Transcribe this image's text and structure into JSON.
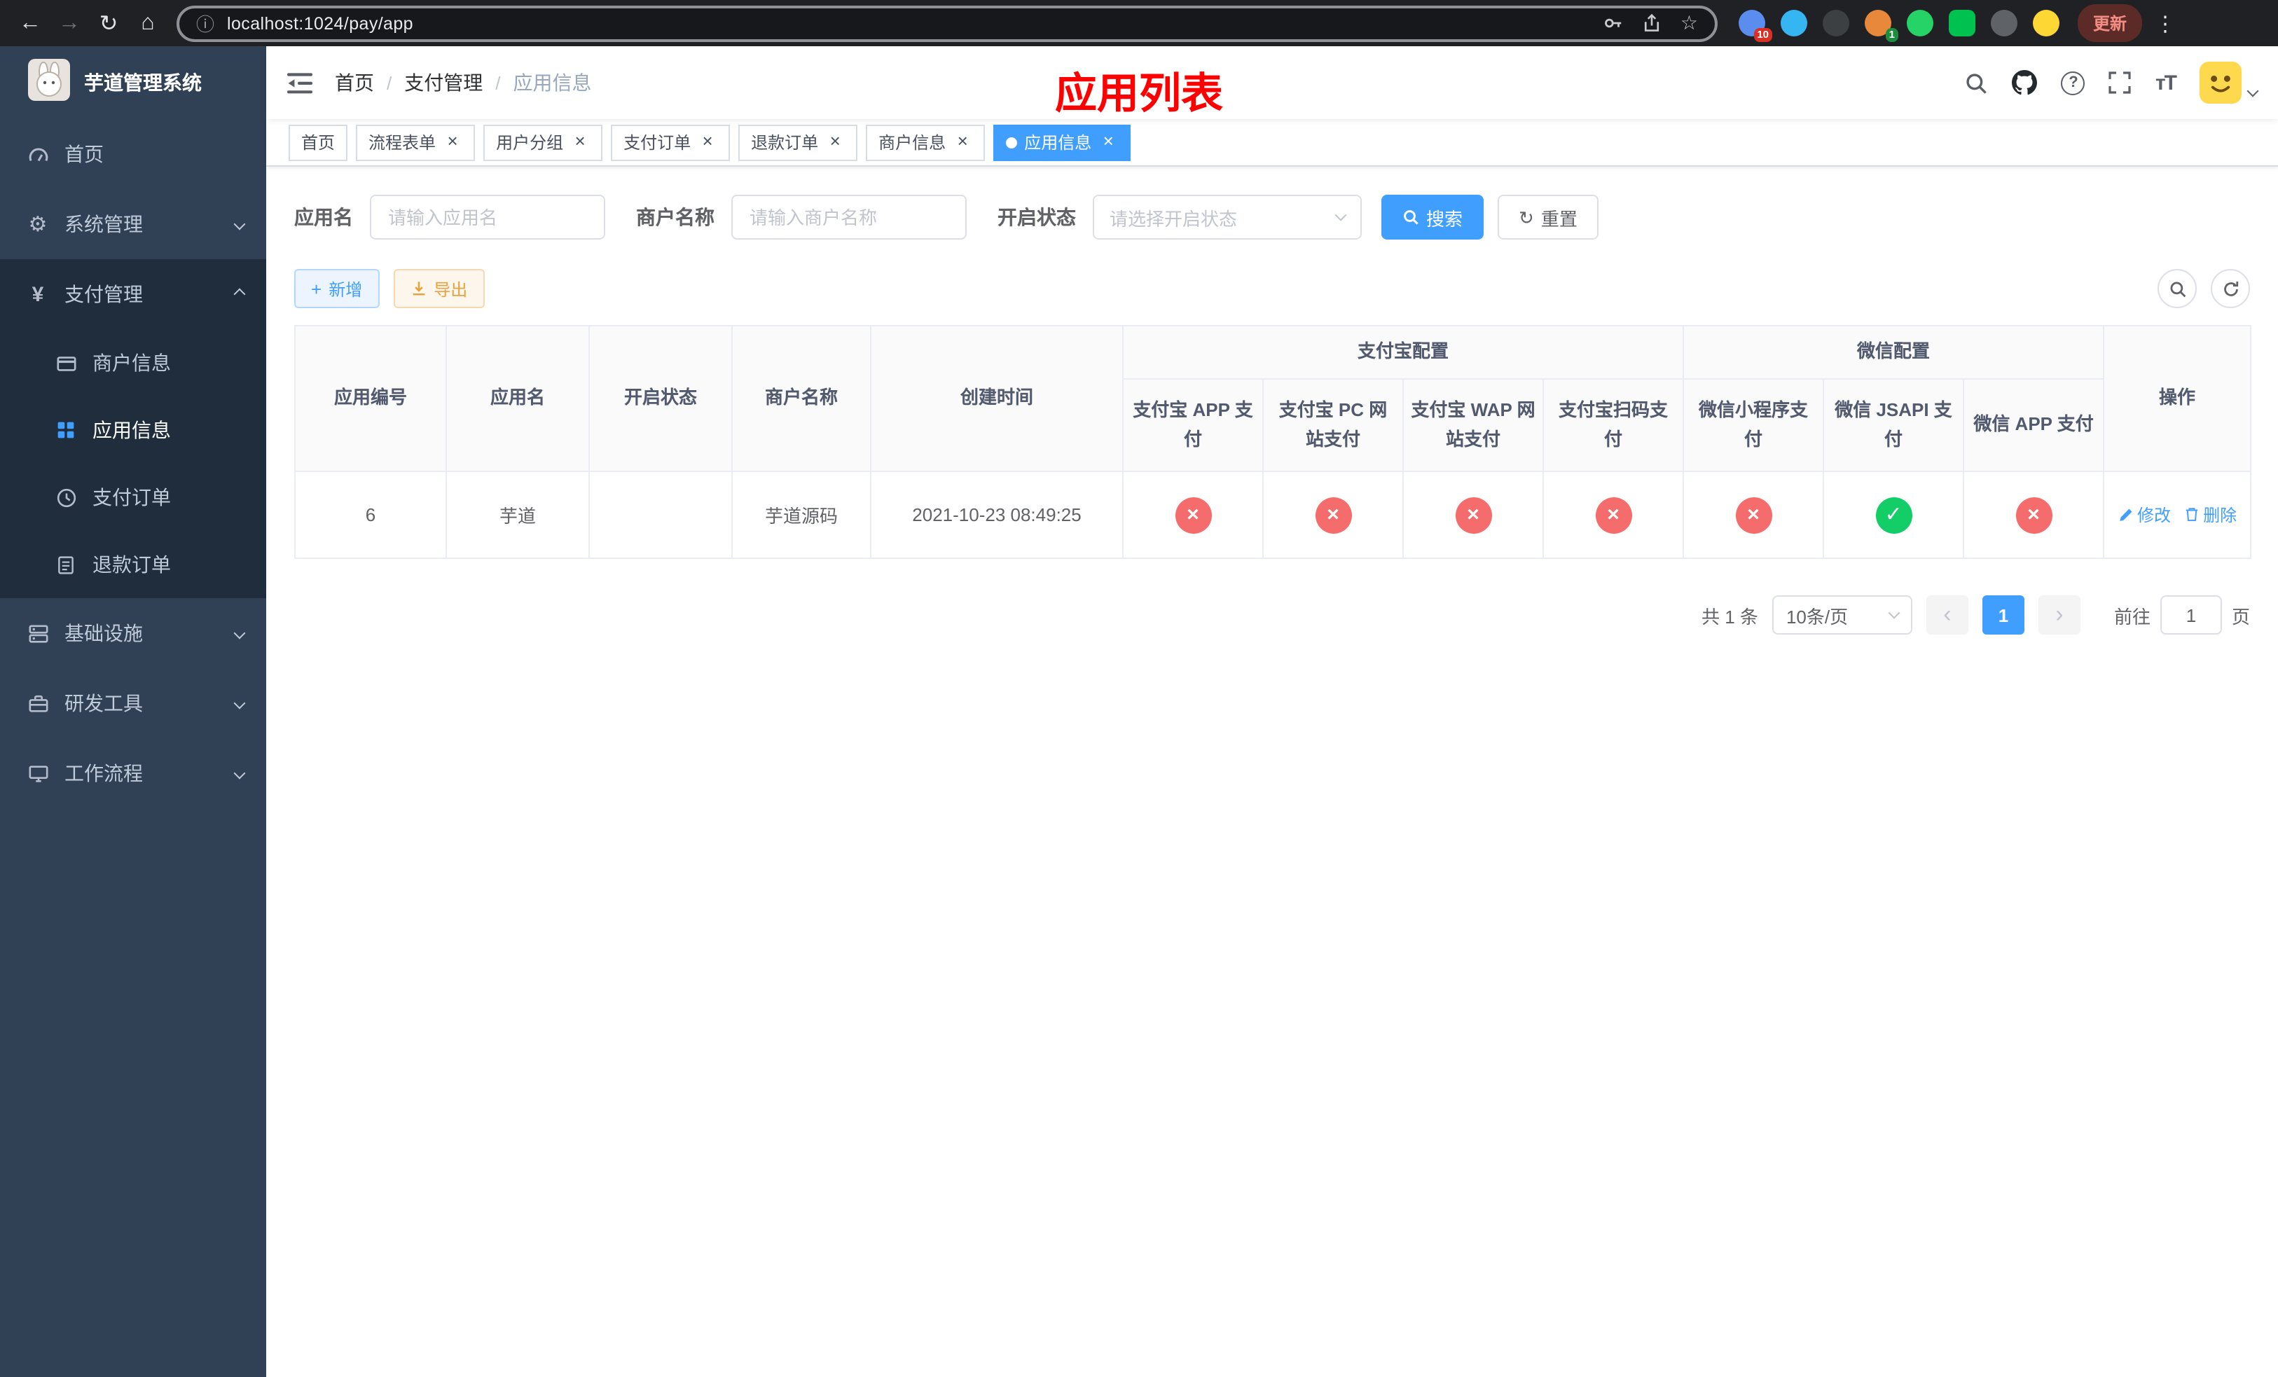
{
  "browser": {
    "url": "localhost:1024/pay/app",
    "update_label": "更新",
    "ext_badge_1": "10",
    "ext_badge_2": "1"
  },
  "icons": {
    "back": "←",
    "forward": "→",
    "reload": "↻",
    "home": "⌂",
    "info": "ⓘ",
    "star": "☆",
    "dots": "⋮",
    "question": "?",
    "close": "×",
    "cross": "×",
    "check": "✓",
    "plus": "+",
    "prev": "‹",
    "next": "›",
    "yen": "¥",
    "gear": "⚙",
    "font_size": "тT",
    "slash": "/"
  },
  "sidebar": {
    "app_title": "芋道管理系统",
    "home": "首页",
    "system": "系统管理",
    "payment": "支付管理",
    "merchant_info": "商户信息",
    "app_info": "应用信息",
    "pay_order": "支付订单",
    "refund_order": "退款订单",
    "infra": "基础设施",
    "dev_tools": "研发工具",
    "workflow": "工作流程"
  },
  "header": {
    "breadcrumb_home": "首页",
    "breadcrumb_section": "支付管理",
    "breadcrumb_current": "应用信息",
    "page_title": "应用列表"
  },
  "tabs": [
    {
      "label": "首页"
    },
    {
      "label": "流程表单"
    },
    {
      "label": "用户分组"
    },
    {
      "label": "支付订单"
    },
    {
      "label": "退款订单"
    },
    {
      "label": "商户信息"
    },
    {
      "label": "应用信息"
    }
  ],
  "filters": {
    "app_name_label": "应用名",
    "app_name_placeholder": "请输入应用名",
    "merchant_label": "商户名称",
    "merchant_placeholder": "请输入商户名称",
    "status_label": "开启状态",
    "status_placeholder": "请选择开启状态",
    "search_label": "搜索",
    "reset_label": "重置"
  },
  "toolbar": {
    "add_label": "新增",
    "export_label": "导出"
  },
  "table": {
    "headers": {
      "app_id": "应用编号",
      "app_name": "应用名",
      "status": "开启状态",
      "merchant_name": "商户名称",
      "create_time": "创建时间",
      "alipay_group": "支付宝配置",
      "wechat_group": "微信配置",
      "alipay_app": "支付宝 APP 支付",
      "alipay_pc": "支付宝 PC 网站支付",
      "alipay_wap": "支付宝 WAP 网站支付",
      "alipay_scan": "支付宝扫码支付",
      "wechat_mini": "微信小程序支付",
      "wechat_jsapi": "微信 JSAPI 支付",
      "wechat_app": "微信 APP 支付",
      "actions": "操作"
    },
    "row": {
      "app_id": "6",
      "app_name": "芋道",
      "status_on": true,
      "merchant_name": "芋道源码",
      "create_time": "2021-10-23 08:49:25",
      "alipay_app": false,
      "alipay_pc": false,
      "alipay_wap": false,
      "alipay_scan": false,
      "wechat_mini": false,
      "wechat_jsapi": true,
      "wechat_app": false,
      "edit_label": "修改",
      "delete_label": "删除"
    }
  },
  "pagination": {
    "total_label": "共 1 条",
    "page_size_label": "10条/页",
    "current_page": "1",
    "goto_label": "前往",
    "goto_value": "1",
    "page_unit": "页"
  },
  "colors": {
    "accent": "#409eff",
    "success": "#13ce66",
    "danger": "#f56c6c",
    "warning": "#e6a23c",
    "title_red": "#ff0000",
    "sidebar_bg": "#304156",
    "submenu_bg": "#1f2d3d"
  }
}
